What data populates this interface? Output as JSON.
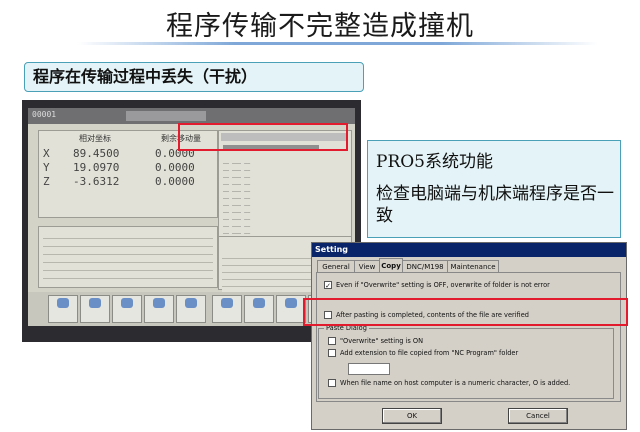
{
  "slide": {
    "title": "程序传输不完整造成撞机",
    "subtitle": "程序在传输过程中丢失（干扰）"
  },
  "callout": {
    "title": "PRO5系统功能",
    "description": "检查电脑端与机床端程序是否一致"
  },
  "cnc_screen": {
    "header_left": "相对坐标",
    "header_right": "剩余移动量",
    "coords": [
      {
        "axis": "X",
        "value": "89.4500",
        "remaining": "0.0000"
      },
      {
        "axis": "Y",
        "value": "19.0970",
        "remaining": "0.0000"
      },
      {
        "axis": "Z",
        "value": "-3.6312",
        "remaining": "0.0000"
      }
    ]
  },
  "settings_dialog": {
    "title": "Setting",
    "tabs": [
      "General",
      "View",
      "Copy",
      "DNC/M198",
      "Maintenance"
    ],
    "active_tab": "Copy",
    "options": {
      "overwrite_folder": "Even if \"Overwrite\" setting is OFF, overwrite of folder is not error",
      "verify_after_paste": "After pasting is completed, contents of the file are verified"
    },
    "paste_dialog": {
      "legend": "Paste  Dialog",
      "overwrite_on": "\"Overwrite\" setting is ON",
      "add_extension": "Add extension to file copied from \"NC Program\" folder",
      "numeric_name": "When file name on host computer is a numeric character, O is added."
    },
    "checked": {
      "overwrite_folder": true,
      "verify_after_paste": false,
      "overwrite_on": false,
      "add_extension": false,
      "numeric_name": false
    },
    "check_mark": "✓",
    "ok_label": "OK",
    "cancel_label": "Cancel"
  },
  "colors": {
    "highlight": "#e21b2f",
    "callout_bg": "#e4f3f7",
    "titlebar": "#0a246a"
  }
}
